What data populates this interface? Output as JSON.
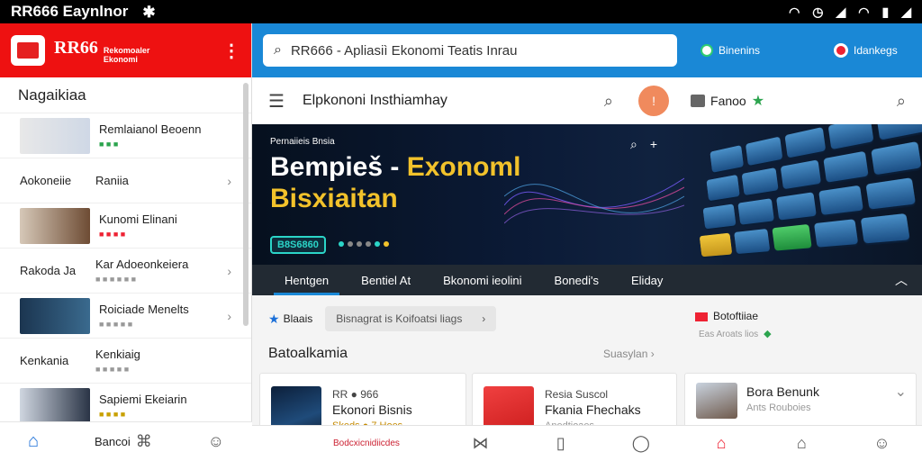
{
  "status": {
    "title": "RR666 Eaynlnor",
    "bt_icon": "bluetooth-icon"
  },
  "left": {
    "brand_big": "RR66",
    "brand_small_1": "Rekomoaler",
    "brand_small_2": "Ekonomi",
    "section_title": "Nagaikiaa",
    "rows": [
      {
        "cat": "",
        "title": "Remlaianol Beoenn",
        "sub": "■ ■ ■"
      },
      {
        "cat": "Aokoneiie",
        "title": "Raniia",
        "sub": ""
      },
      {
        "cat": "",
        "title": "Kunomi Elinani",
        "sub": "■ ■ ■ ■"
      },
      {
        "cat": "Rakoda Ja",
        "title": "Kar Adoeonkeiera",
        "sub": "■ ■ ■ ■ ■ ■"
      },
      {
        "cat": "",
        "title": "Roiciade Menelts",
        "sub": "■ ■ ■ ■ ■"
      },
      {
        "cat": "Kenkania",
        "title": "Kenkiaig",
        "sub": "■ ■ ■ ■ ■"
      },
      {
        "cat": "",
        "title": "Sapiemi Ekeiarin",
        "sub": "■ ■ ■ ■"
      }
    ],
    "bottom_label": "Bancoi"
  },
  "search": {
    "placeholder": "RR666 - Apliasiì Ekonomi Teatis Inrau"
  },
  "chips": {
    "one": "Binenins",
    "two": "Idankegs"
  },
  "header": {
    "title": "Elpkononi Insthiamhay",
    "fav_label": "Fanoo"
  },
  "banner": {
    "sup": "Pernaiieis Bnsia",
    "line1_a": "Bempieš - ",
    "line1_b": "Exonoml",
    "line2": "Bisxiaitan",
    "pill": "B8S6860"
  },
  "tabs": [
    "Hentgen",
    "Bentiel At",
    "Bkonomi ieolini",
    "Bonedi's",
    "Eliday"
  ],
  "filters": {
    "one": "Blaais",
    "two": "Bisnagrat is Koifoatsi liags"
  },
  "notif": {
    "title": "Botoftiiae",
    "sub": "Eas Aroats lios"
  },
  "section": {
    "title": "Batoalkamia",
    "more": "Suasylan"
  },
  "cards": [
    {
      "t1": "RR ● 966",
      "t2": "Ekonori Bisnis",
      "t3": "Skeds ● 7 Hoes"
    },
    {
      "t1": "Resia Suscol",
      "t2": "Fkania Fhechaks",
      "t3": "Anedtioaes"
    },
    {
      "t1": "",
      "t2": "Bora Benunk",
      "t3": "Ants Rouboies"
    }
  ],
  "bottom": {
    "card_meta": "Bodcxicnidiicdes"
  }
}
